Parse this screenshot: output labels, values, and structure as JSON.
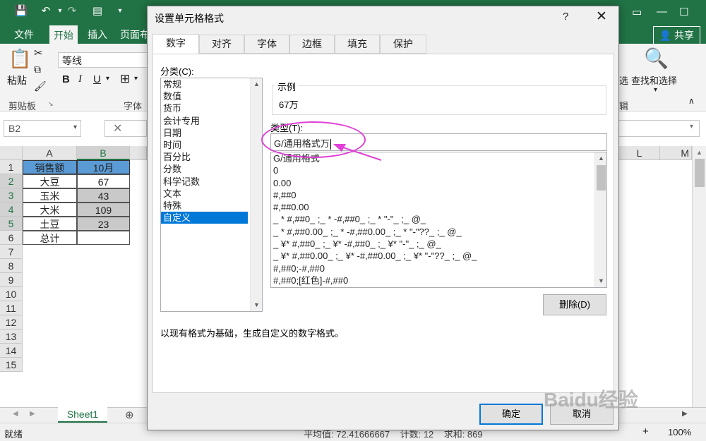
{
  "excel": {
    "ribbon_tabs": [
      "文件",
      "开始",
      "插入",
      "页面布"
    ],
    "share": "共享",
    "font_name": "等线",
    "paste_label": "粘贴",
    "clipboard_group": "剪贴板",
    "font_group": "字体",
    "find_label": "查找和选择",
    "filter_partial": "选",
    "edit_partial": "辑",
    "name_box": "B2",
    "col_headers": [
      "A",
      "B",
      "L",
      "M"
    ],
    "row_numbers": [
      "1",
      "2",
      "3",
      "4",
      "5",
      "6",
      "7",
      "8",
      "9",
      "10",
      "11",
      "12",
      "13",
      "14",
      "15"
    ],
    "cells": {
      "a1": "销售额",
      "b1": "10月",
      "a2": "大豆",
      "b2": "67",
      "a3": "玉米",
      "b3": "43",
      "a4": "大米",
      "b4": "109",
      "a5": "土豆",
      "b5": "23",
      "a6": "总计"
    },
    "sheet_tab": "Sheet1",
    "status_ready": "就绪",
    "status_stats": "平均值: 72.41666667    计数: 12    求和: 869",
    "zoom": "100%"
  },
  "dialog": {
    "title": "设置单元格格式",
    "help": "?",
    "tabs": [
      "数字",
      "对齐",
      "字体",
      "边框",
      "填充",
      "保护"
    ],
    "category_label": "分类(C):",
    "categories": [
      "常规",
      "数值",
      "货币",
      "会计专用",
      "日期",
      "时间",
      "百分比",
      "分数",
      "科学记数",
      "文本",
      "特殊",
      "自定义"
    ],
    "selected_category": "自定义",
    "sample_label": "示例",
    "sample_value": "67万",
    "type_label": "类型(T):",
    "type_value": "G/通用格式万",
    "formats": [
      "G/通用格式",
      "0",
      "0.00",
      "#,##0",
      "#,##0.00",
      "_ * #,##0_ ;_ * -#,##0_ ;_ * \"-\"_ ;_ @_",
      "_ * #,##0.00_ ;_ * -#,##0.00_ ;_ * \"-\"??_ ;_ @_",
      "_ ¥* #,##0_ ;_ ¥* -#,##0_ ;_ ¥* \"-\"_ ;_ @_",
      "_ ¥* #,##0.00_ ;_ ¥* -#,##0.00_ ;_ ¥* \"-\"??_ ;_ @_",
      "#,##0;-#,##0",
      "#,##0;[红色]-#,##0"
    ],
    "delete_button": "删除(D)",
    "description": "以现有格式为基础，生成自定义的数字格式。",
    "ok_button": "确定",
    "cancel_button": "取消"
  },
  "watermark": "Baidu经验"
}
